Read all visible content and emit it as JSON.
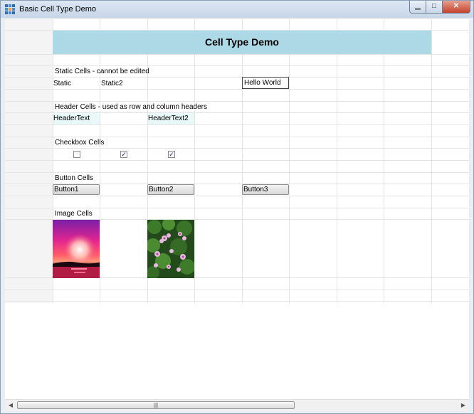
{
  "window": {
    "title": "Basic Cell Type Demo",
    "minimize_glyph": "▁",
    "maximize_glyph": "□",
    "close_glyph": "✕"
  },
  "sheet": {
    "title": "Cell Type Demo",
    "sections": {
      "static": {
        "heading": "Static Cells - cannot be edited",
        "cells": [
          "Static",
          "Static2"
        ],
        "edit_value": "Hello World"
      },
      "header": {
        "heading": "Header Cells - used as row and column headers",
        "cells": [
          "HeaderText",
          "HeaderText2"
        ]
      },
      "checkbox": {
        "heading": "Checkbox Cells",
        "checks": [
          false,
          true,
          true
        ]
      },
      "button": {
        "heading": "Button Cells",
        "buttons": [
          "Button1",
          "Button2",
          "Button3"
        ]
      },
      "image": {
        "heading": "Image Cells",
        "images": [
          "sunset-image",
          "flowers-image"
        ]
      }
    }
  },
  "scrollbar": {
    "left_arrow": "◀",
    "right_arrow": "▶",
    "grip": "|||"
  },
  "colors": {
    "banner": "#add8e6",
    "header_cell": "#e9f8f8",
    "check_mark": "#23238a"
  }
}
